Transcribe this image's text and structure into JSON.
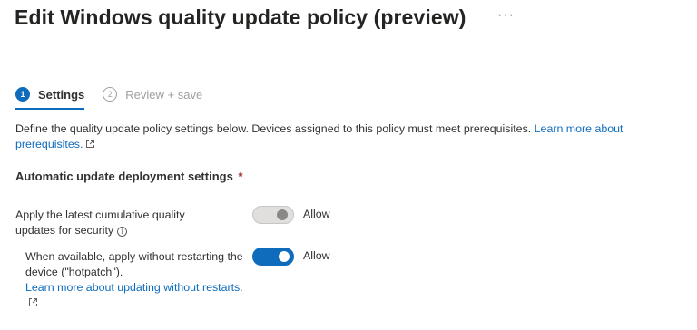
{
  "header": {
    "title": "Edit Windows quality update policy (preview)",
    "more_label": "···"
  },
  "wizard": {
    "steps": [
      {
        "number": "1",
        "label": "Settings"
      },
      {
        "number": "2",
        "label": "Review + save"
      }
    ]
  },
  "description": {
    "text": "Define the quality update policy settings below. Devices assigned to this policy must meet prerequisites. ",
    "link": "Learn more about prerequisites."
  },
  "section": {
    "heading": "Automatic update deployment settings",
    "required_marker": "*"
  },
  "settings": [
    {
      "label": "Apply the latest cumulative quality updates for security",
      "toggle_state": "Allow",
      "enabled": false
    },
    {
      "label": "When available, apply without restarting the device (\"hotpatch\").",
      "link": "Learn more about updating without restarts.",
      "toggle_state": "Allow",
      "enabled": true
    }
  ],
  "colors": {
    "accent": "#0f6cbd",
    "required": "#a4262c",
    "text": "#323130"
  }
}
